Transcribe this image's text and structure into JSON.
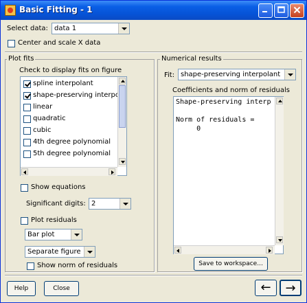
{
  "window": {
    "title": "Basic Fitting - 1"
  },
  "top": {
    "select_data_label": "Select data:",
    "select_data_value": "data 1",
    "center_scale_label": "Center and scale X data"
  },
  "plot_fits": {
    "title": "Plot fits",
    "instruction": "Check to display fits on figure",
    "items": [
      {
        "label": "spline interpolant",
        "checked": true
      },
      {
        "label": "shape-preserving interpo",
        "checked": true
      },
      {
        "label": "linear",
        "checked": false
      },
      {
        "label": "quadratic",
        "checked": false
      },
      {
        "label": "cubic",
        "checked": false
      },
      {
        "label": "4th degree polynomial",
        "checked": false
      },
      {
        "label": "5th degree polynomial",
        "checked": false
      }
    ],
    "show_equations_label": "Show equations",
    "significant_digits_label": "Significant digits:",
    "significant_digits_value": "2",
    "plot_residuals_label": "Plot residuals",
    "residual_plot_type": "Bar plot",
    "residual_location": "Separate figure",
    "show_norm_label": "Show norm of residuals"
  },
  "numerical": {
    "title": "Numerical results",
    "fit_label": "Fit:",
    "fit_value": "shape-preserving interpolant",
    "coefficients_label": "Coefficients and norm of residuals",
    "results_lines": [
      "Shape-preserving interp",
      "",
      "Norm of residuals =",
      "     0"
    ],
    "save_button": "Save to workspace..."
  },
  "bottom": {
    "help_button": "Help",
    "close_button": "Close",
    "back_arrow": "←",
    "forward_arrow": "→"
  },
  "icons": {
    "title_app": "matlab-icon",
    "minimize": "minimize-icon",
    "maximize": "maximize-icon",
    "close": "close-icon"
  }
}
